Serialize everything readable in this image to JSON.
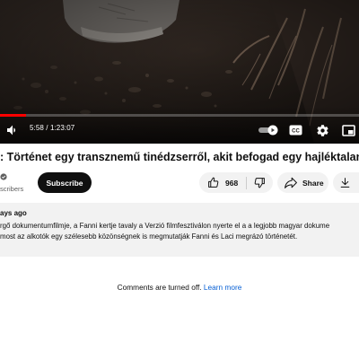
{
  "player": {
    "current_time": "5:58",
    "duration": "1:23:07",
    "timecode": "5:58 / 1:23:07",
    "progress_fraction": 0.072,
    "accent_color": "#ff0000",
    "icons": [
      "volume-icon",
      "autoplay-toggle-icon",
      "captions-icon",
      "settings-icon",
      "miniplayer-icon"
    ]
  },
  "video": {
    "title": ": Történet egy transznemű tinédzserről, akit befogad egy hajléktalan"
  },
  "channel": {
    "subscribers_text": "scribers",
    "subscribe_label": "Subscribe"
  },
  "actions": {
    "like_count": "968",
    "share_label": "Share",
    "icons": [
      "thumb-up-icon",
      "thumb-down-icon",
      "share-icon",
      "download-icon"
    ]
  },
  "description": {
    "date": "ays ago",
    "line1": "rgő dokumentumfilmje, a Fanni kertje tavaly a Verzió filmfesztiválon nyerte el a a legjobb magyar dokume",
    "line2": " most az alkotók egy szélesebb közönségnek is megmutatják Fanni és Laci megrázó történetét."
  },
  "comments": {
    "status_text": "Comments are turned off.",
    "learn_more_label": "Learn more"
  }
}
